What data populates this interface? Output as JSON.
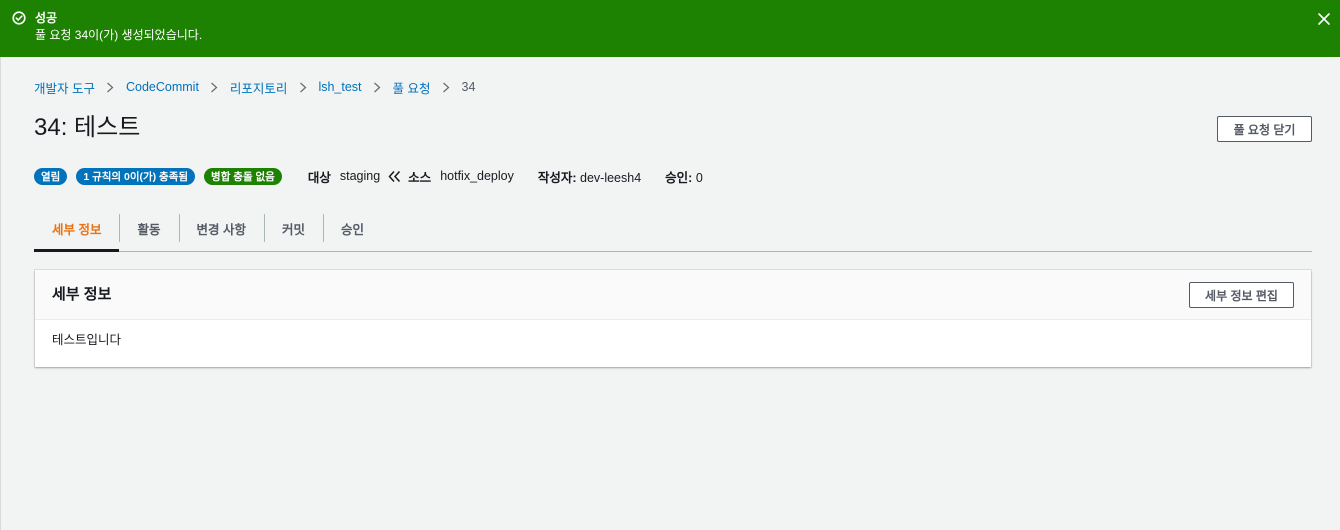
{
  "flash": {
    "title": "성공",
    "message": "풀 요청 34이(가) 생성되었습니다.",
    "type": "success",
    "color": "#1d8102",
    "icon": "check-circle-icon",
    "close_icon": "close-icon"
  },
  "breadcrumb": {
    "items": [
      "개발자 도구",
      "CodeCommit",
      "리포지토리",
      "lsh_test",
      "풀 요청"
    ],
    "current": "34"
  },
  "header": {
    "title": "34: 테스트",
    "close_button_label": "풀 요청 닫기"
  },
  "status": {
    "badges": [
      {
        "label": "열림",
        "color": "#0073bb"
      },
      {
        "label": "1 규칙의 0이(가) 충족됨",
        "color": "#0073bb"
      },
      {
        "label": "병합 충돌 없음",
        "color": "#1d8102"
      }
    ],
    "target_label": "대상",
    "target_value": "staging",
    "source_label": "소스",
    "source_value": "hotfix_deploy",
    "author_label": "작성자:",
    "author_value": "dev-leesh4",
    "approvals_label": "승인:",
    "approvals_value": "0"
  },
  "tabs": [
    {
      "label": "세부 정보",
      "active": true
    },
    {
      "label": "활동",
      "active": false
    },
    {
      "label": "변경 사항",
      "active": false
    },
    {
      "label": "커밋",
      "active": false
    },
    {
      "label": "승인",
      "active": false
    }
  ],
  "details_panel": {
    "title": "세부 정보",
    "edit_button_label": "세부 정보 편집",
    "description": "테스트입니다"
  },
  "colors": {
    "accent_tab": "#ec7211",
    "link": "#0073bb",
    "success": "#1d8102"
  }
}
